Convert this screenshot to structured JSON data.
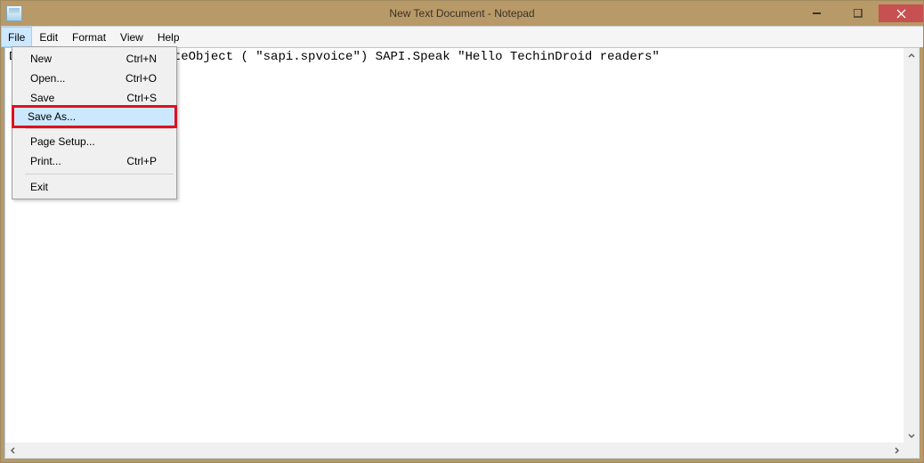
{
  "window": {
    "title": "New Text Document - Notepad"
  },
  "menubar": {
    "items": [
      {
        "label": "File"
      },
      {
        "label": "Edit"
      },
      {
        "label": "Format"
      },
      {
        "label": "View"
      },
      {
        "label": "Help"
      }
    ]
  },
  "editor": {
    "content": "Dim SAPI Set SAPI=CreateObject ( \"sapi.spvoice\") SAPI.Speak \"Hello TechinDroid readers\""
  },
  "file_menu": {
    "items": [
      {
        "label": "New",
        "shortcut": "Ctrl+N",
        "highlight": false
      },
      {
        "label": "Open...",
        "shortcut": "Ctrl+O",
        "highlight": false
      },
      {
        "label": "Save",
        "shortcut": "Ctrl+S",
        "highlight": false
      },
      {
        "label": "Save As...",
        "shortcut": "",
        "highlight": true
      },
      {
        "sep": true
      },
      {
        "label": "Page Setup...",
        "shortcut": "",
        "highlight": false
      },
      {
        "label": "Print...",
        "shortcut": "Ctrl+P",
        "highlight": false
      },
      {
        "sep": true
      },
      {
        "label": "Exit",
        "shortcut": "",
        "highlight": false
      }
    ]
  }
}
